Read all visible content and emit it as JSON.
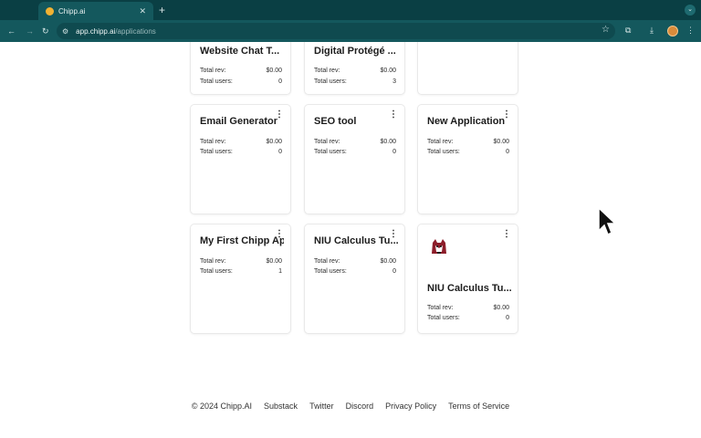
{
  "browser": {
    "tab_title": "Chipp.ai",
    "url_host": "app.chipp.ai",
    "url_path": "/applications"
  },
  "cards": [
    {
      "name": "Website Chat T...",
      "rev_label": "Total rev:",
      "rev": "$0.00",
      "users_label": "Total users:",
      "users": "0"
    },
    {
      "name": "Digital Protégé ...",
      "rev_label": "Total rev:",
      "rev": "$0.00",
      "users_label": "Total users:",
      "users": "3"
    },
    {
      "name": "",
      "rev_label": "",
      "rev": "",
      "users_label": "",
      "users": ""
    },
    {
      "name": "Email Generator",
      "rev_label": "Total rev:",
      "rev": "$0.00",
      "users_label": "Total users:",
      "users": "0"
    },
    {
      "name": "SEO tool",
      "rev_label": "Total rev:",
      "rev": "$0.00",
      "users_label": "Total users:",
      "users": "0"
    },
    {
      "name": "New Application",
      "rev_label": "Total rev:",
      "rev": "$0.00",
      "users_label": "Total users:",
      "users": "0"
    },
    {
      "name": "My First Chipp Ap",
      "rev_label": "Total rev:",
      "rev": "$0.00",
      "users_label": "Total users:",
      "users": "1"
    },
    {
      "name": "NIU Calculus Tu...",
      "rev_label": "Total rev:",
      "rev": "$0.00",
      "users_label": "Total users:",
      "users": "0"
    },
    {
      "name": "NIU Calculus Tu...",
      "rev_label": "Total rev:",
      "rev": "$0.00",
      "users_label": "Total users:",
      "users": "0"
    }
  ],
  "footer": {
    "copyright": "© 2024 Chipp.AI",
    "links": [
      "Substack",
      "Twitter",
      "Discord",
      "Privacy Policy",
      "Terms of Service"
    ]
  },
  "icons": {
    "menu": "kebab-menu-icon",
    "cursor": "mouse-pointer-icon",
    "logo": "husky-logo-icon"
  }
}
